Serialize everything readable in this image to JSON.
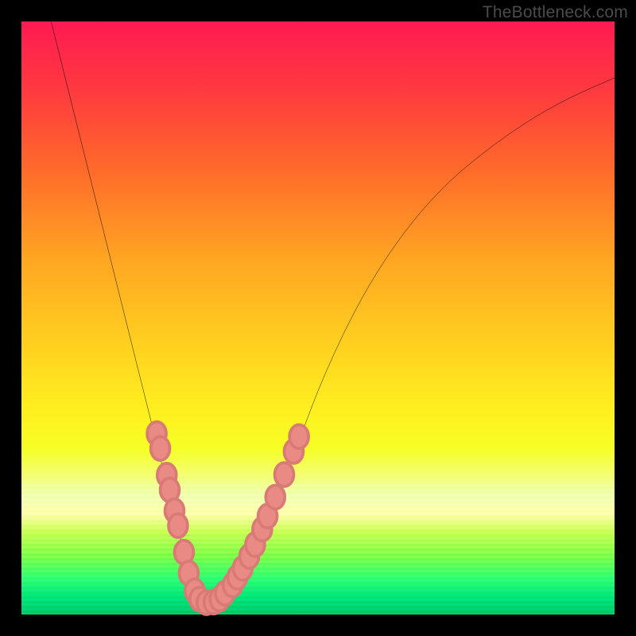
{
  "watermark": "TheBottleneck.com",
  "chart_data": {
    "type": "line",
    "title": "",
    "xlabel": "",
    "ylabel": "",
    "xlim": [
      0,
      100
    ],
    "ylim": [
      0,
      100
    ],
    "curve": {
      "x": [
        5,
        7,
        9,
        11,
        13,
        15,
        17,
        19,
        21,
        23,
        25,
        27,
        28.5,
        30,
        31.5,
        33.5,
        36,
        39,
        42,
        46,
        50,
        55,
        60,
        66,
        72,
        78,
        85,
        92,
        100
      ],
      "y": [
        100,
        92,
        84,
        76,
        68,
        60,
        52,
        44,
        36,
        28,
        20,
        12,
        6,
        2.5,
        2,
        2.5,
        5,
        10,
        17,
        27,
        38,
        49,
        58,
        66.5,
        73,
        78,
        83,
        87,
        90.5
      ]
    },
    "clusters": [
      {
        "name": "left-cluster",
        "points": [
          {
            "x": 22.8,
            "y": 30.5
          },
          {
            "x": 23.4,
            "y": 28.0
          },
          {
            "x": 24.5,
            "y": 23.5
          },
          {
            "x": 25.0,
            "y": 21.0
          },
          {
            "x": 25.8,
            "y": 17.5
          },
          {
            "x": 26.4,
            "y": 15.0
          },
          {
            "x": 27.4,
            "y": 10.5
          },
          {
            "x": 28.2,
            "y": 7.0
          },
          {
            "x": 29.2,
            "y": 4.0
          }
        ]
      },
      {
        "name": "valley-cluster",
        "points": [
          {
            "x": 30.0,
            "y": 2.6
          },
          {
            "x": 31.2,
            "y": 2.0
          },
          {
            "x": 32.4,
            "y": 2.1
          },
          {
            "x": 33.4,
            "y": 2.6
          }
        ]
      },
      {
        "name": "right-cluster",
        "points": [
          {
            "x": 34.3,
            "y": 3.6
          },
          {
            "x": 35.6,
            "y": 5.0
          },
          {
            "x": 36.4,
            "y": 6.3
          },
          {
            "x": 37.3,
            "y": 7.8
          },
          {
            "x": 38.4,
            "y": 9.8
          },
          {
            "x": 39.4,
            "y": 11.8
          },
          {
            "x": 40.6,
            "y": 14.4
          },
          {
            "x": 41.5,
            "y": 16.6
          },
          {
            "x": 42.8,
            "y": 19.8
          },
          {
            "x": 44.3,
            "y": 23.6
          },
          {
            "x": 45.9,
            "y": 27.5
          },
          {
            "x": 46.8,
            "y": 30.0
          }
        ]
      }
    ],
    "marker_style": {
      "color": "#e98a85",
      "radius": 1.6
    }
  }
}
